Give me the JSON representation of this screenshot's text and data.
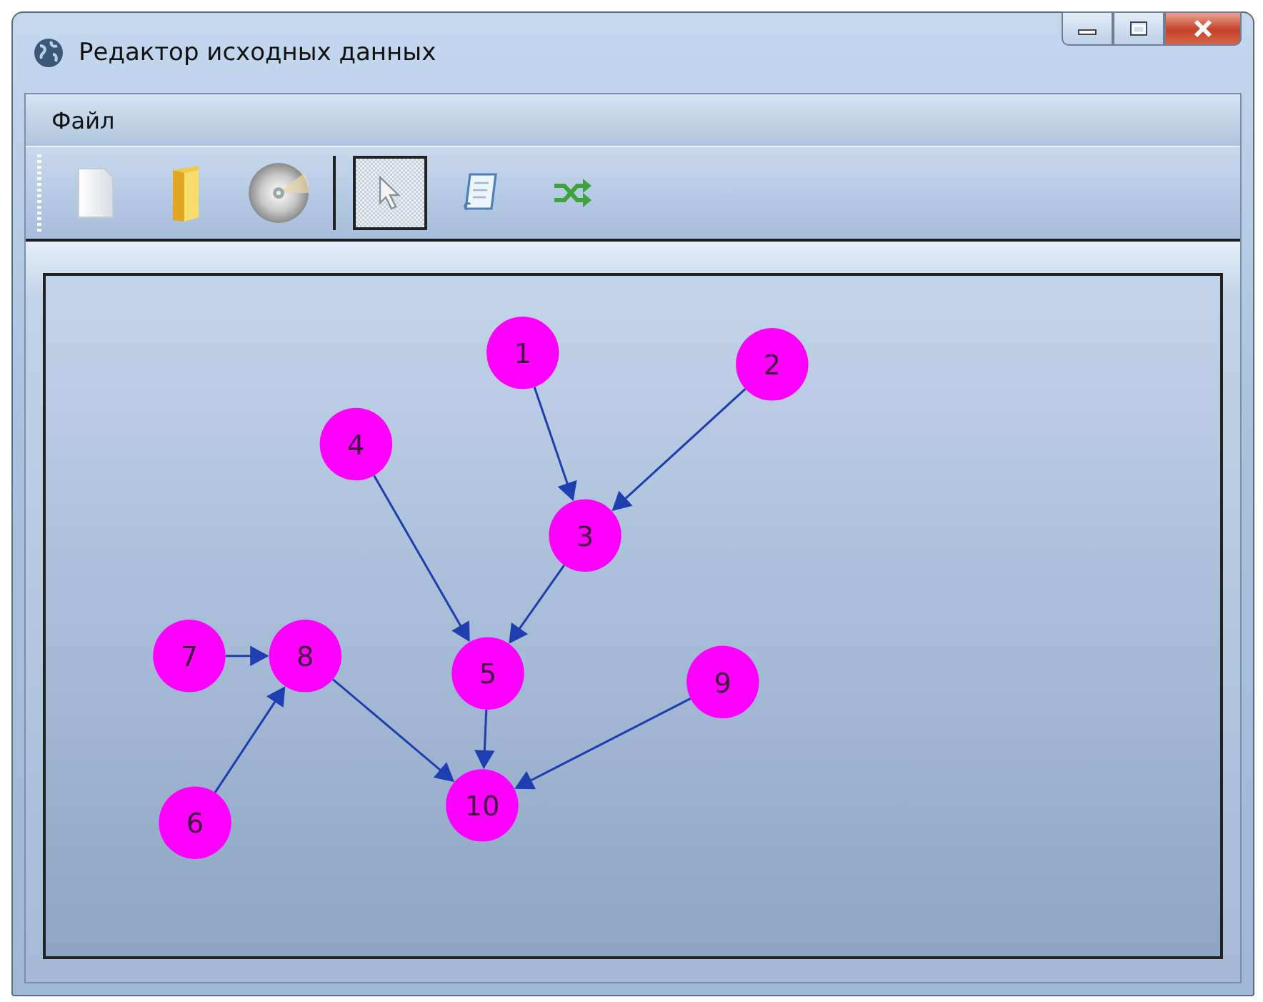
{
  "window": {
    "title": "Редактор исходных данных"
  },
  "menu": [
    "Файл"
  ],
  "toolbar": [
    {
      "selected": false
    },
    {
      "selected": false
    },
    {
      "selected": false
    },
    {
      "selected": true
    },
    {
      "selected": false
    },
    {
      "selected": false
    }
  ],
  "graph": {
    "nodes": [
      {
        "label": "1"
      },
      {
        "label": "2"
      },
      {
        "label": "3"
      },
      {
        "label": "4"
      },
      {
        "label": "5"
      },
      {
        "label": "6"
      },
      {
        "label": "7"
      },
      {
        "label": "8"
      },
      {
        "label": "9"
      },
      {
        "label": "10"
      }
    ]
  }
}
